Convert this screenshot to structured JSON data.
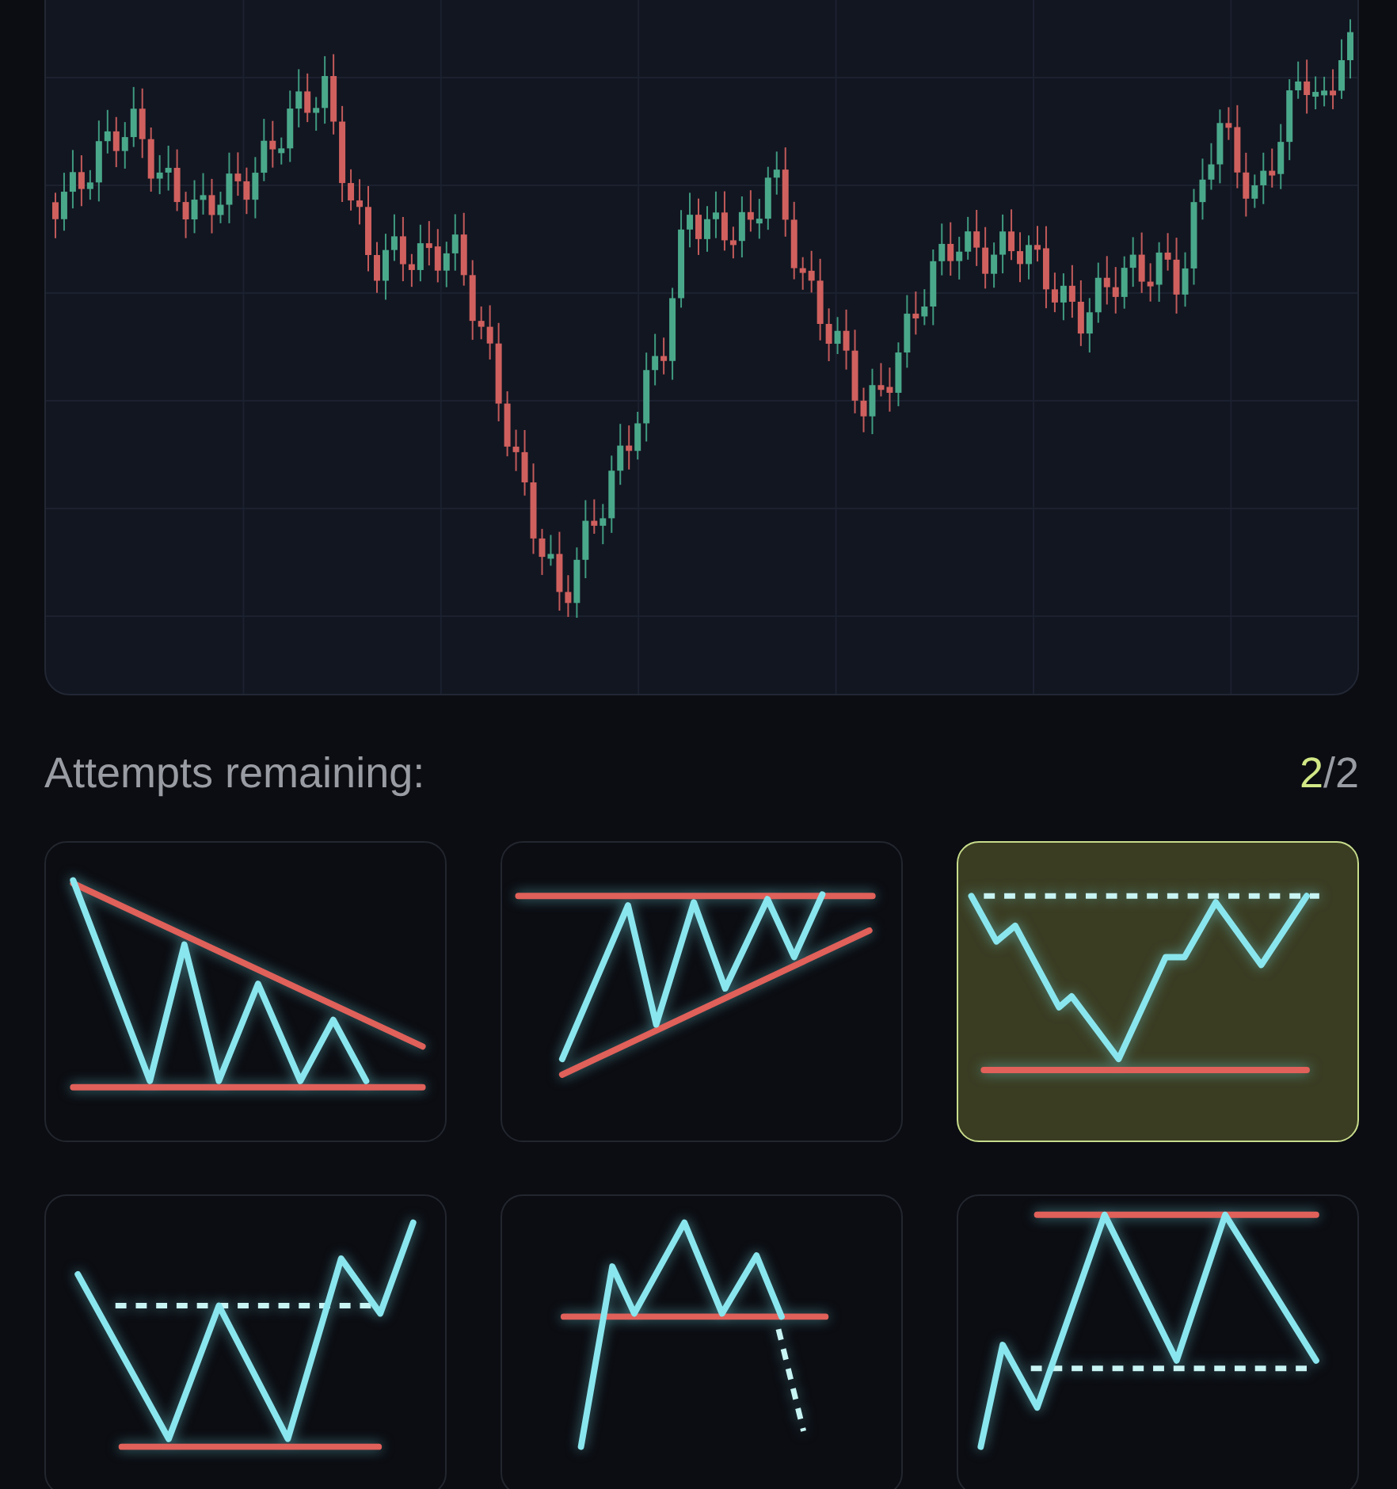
{
  "attempts": {
    "label": "Attempts remaining:",
    "count": "2",
    "total": "/2"
  },
  "patterns": [
    {
      "kind": "descending",
      "selected": false
    },
    {
      "kind": "ascending",
      "selected": false
    },
    {
      "kind": "bottom",
      "selected": true
    },
    {
      "kind": "doublebottom",
      "selected": false
    },
    {
      "kind": "breakdown",
      "selected": false
    },
    {
      "kind": "range",
      "selected": false
    }
  ]
}
